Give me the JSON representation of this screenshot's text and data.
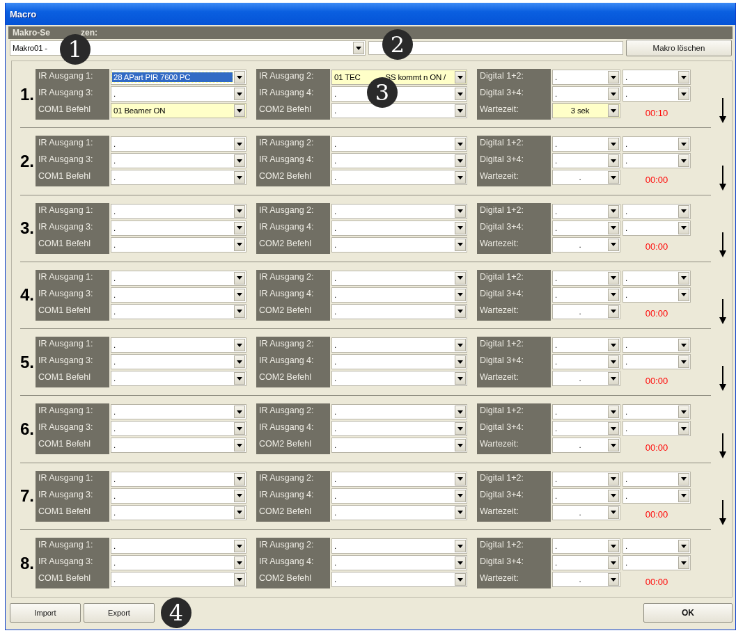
{
  "window": {
    "title": "Macro"
  },
  "header": {
    "label_parts": [
      "Makro-Se",
      "zen:"
    ],
    "macro_combo": {
      "value": "Makro01 -"
    },
    "delete_button": "Makro löschen"
  },
  "callouts": [
    "1",
    "2",
    "3",
    "4"
  ],
  "rows": [
    {
      "number": "1.",
      "time": "00:10",
      "arrow": true,
      "groups": [
        {
          "lines": [
            {
              "label": "IR Ausgang 1:",
              "combos": [
                {
                  "value": "28 APart PIR 7600 PC",
                  "highlighted": false,
                  "focused": true
                }
              ]
            },
            {
              "label": "IR Ausgang 3:",
              "combos": [
                {
                  "value": ".",
                  "highlighted": false,
                  "focused": false
                }
              ]
            },
            {
              "label": "COM1 Befehl",
              "combos": [
                {
                  "value": "01 Beamer ON",
                  "highlighted": true,
                  "focused": false
                }
              ]
            }
          ]
        },
        {
          "lines": [
            {
              "label": "IR Ausgang 2:",
              "combos": [
                {
                  "value_parts": [
                    "01 TEC",
                    "SS kommt n ON /"
                  ],
                  "highlighted": true,
                  "focused": false
                }
              ]
            },
            {
              "label": "IR Ausgang 4:",
              "combos": [
                {
                  "value": ".",
                  "highlighted": false,
                  "focused": false
                }
              ]
            },
            {
              "label": "COM2 Befehl",
              "combos": [
                {
                  "value": ".",
                  "highlighted": false,
                  "focused": false
                }
              ]
            }
          ]
        },
        {
          "lines": [
            {
              "label": "Digital 1+2:",
              "combos": [
                {
                  "value": ".",
                  "highlighted": false,
                  "focused": false
                },
                {
                  "value": ".",
                  "highlighted": false,
                  "focused": false
                }
              ]
            },
            {
              "label": "Digital 3+4:",
              "combos": [
                {
                  "value": ".",
                  "highlighted": false,
                  "focused": false
                },
                {
                  "value": ".",
                  "highlighted": false,
                  "focused": false
                }
              ]
            },
            {
              "label": "Wartezeit:",
              "combos": [
                {
                  "value": "3  sek",
                  "highlighted": true,
                  "focused": false
                }
              ]
            }
          ]
        }
      ]
    },
    {
      "number": "2.",
      "time": "00:00",
      "arrow": true,
      "groups": [
        {
          "lines": [
            {
              "label": "IR Ausgang 1:",
              "combos": [
                {
                  "value": ".",
                  "highlighted": false,
                  "focused": false
                }
              ]
            },
            {
              "label": "IR Ausgang 3:",
              "combos": [
                {
                  "value": ".",
                  "highlighted": false,
                  "focused": false
                }
              ]
            },
            {
              "label": "COM1 Befehl",
              "combos": [
                {
                  "value": ".",
                  "highlighted": false,
                  "focused": false
                }
              ]
            }
          ]
        },
        {
          "lines": [
            {
              "label": "IR Ausgang 2:",
              "combos": [
                {
                  "value": ".",
                  "highlighted": false,
                  "focused": false
                }
              ]
            },
            {
              "label": "IR Ausgang 4:",
              "combos": [
                {
                  "value": ".",
                  "highlighted": false,
                  "focused": false
                }
              ]
            },
            {
              "label": "COM2 Befehl",
              "combos": [
                {
                  "value": ".",
                  "highlighted": false,
                  "focused": false
                }
              ]
            }
          ]
        },
        {
          "lines": [
            {
              "label": "Digital 1+2:",
              "combos": [
                {
                  "value": ".",
                  "highlighted": false,
                  "focused": false
                },
                {
                  "value": ".",
                  "highlighted": false,
                  "focused": false
                }
              ]
            },
            {
              "label": "Digital 3+4:",
              "combos": [
                {
                  "value": ".",
                  "highlighted": false,
                  "focused": false
                },
                {
                  "value": ".",
                  "highlighted": false,
                  "focused": false
                }
              ]
            },
            {
              "label": "Wartezeit:",
              "combos": [
                {
                  "value": ".",
                  "highlighted": false,
                  "focused": false
                }
              ]
            }
          ]
        }
      ]
    },
    {
      "number": "3.",
      "time": "00:00",
      "arrow": true,
      "groups": [
        {
          "lines": [
            {
              "label": "IR Ausgang 1:",
              "combos": [
                {
                  "value": ".",
                  "highlighted": false,
                  "focused": false
                }
              ]
            },
            {
              "label": "IR Ausgang 3:",
              "combos": [
                {
                  "value": ".",
                  "highlighted": false,
                  "focused": false
                }
              ]
            },
            {
              "label": "COM1 Befehl",
              "combos": [
                {
                  "value": ".",
                  "highlighted": false,
                  "focused": false
                }
              ]
            }
          ]
        },
        {
          "lines": [
            {
              "label": "IR Ausgang 2:",
              "combos": [
                {
                  "value": ".",
                  "highlighted": false,
                  "focused": false
                }
              ]
            },
            {
              "label": "IR Ausgang 4:",
              "combos": [
                {
                  "value": ".",
                  "highlighted": false,
                  "focused": false
                }
              ]
            },
            {
              "label": "COM2 Befehl",
              "combos": [
                {
                  "value": ".",
                  "highlighted": false,
                  "focused": false
                }
              ]
            }
          ]
        },
        {
          "lines": [
            {
              "label": "Digital 1+2:",
              "combos": [
                {
                  "value": ".",
                  "highlighted": false,
                  "focused": false
                },
                {
                  "value": ".",
                  "highlighted": false,
                  "focused": false
                }
              ]
            },
            {
              "label": "Digital 3+4:",
              "combos": [
                {
                  "value": ".",
                  "highlighted": false,
                  "focused": false
                },
                {
                  "value": ".",
                  "highlighted": false,
                  "focused": false
                }
              ]
            },
            {
              "label": "Wartezeit:",
              "combos": [
                {
                  "value": ".",
                  "highlighted": false,
                  "focused": false
                }
              ]
            }
          ]
        }
      ]
    },
    {
      "number": "4.",
      "time": "00:00",
      "arrow": true,
      "groups": [
        {
          "lines": [
            {
              "label": "IR Ausgang 1:",
              "combos": [
                {
                  "value": ".",
                  "highlighted": false,
                  "focused": false
                }
              ]
            },
            {
              "label": "IR Ausgang 3:",
              "combos": [
                {
                  "value": ".",
                  "highlighted": false,
                  "focused": false
                }
              ]
            },
            {
              "label": "COM1 Befehl",
              "combos": [
                {
                  "value": ".",
                  "highlighted": false,
                  "focused": false
                }
              ]
            }
          ]
        },
        {
          "lines": [
            {
              "label": "IR Ausgang 2:",
              "combos": [
                {
                  "value": ".",
                  "highlighted": false,
                  "focused": false
                }
              ]
            },
            {
              "label": "IR Ausgang 4:",
              "combos": [
                {
                  "value": ".",
                  "highlighted": false,
                  "focused": false
                }
              ]
            },
            {
              "label": "COM2 Befehl",
              "combos": [
                {
                  "value": ".",
                  "highlighted": false,
                  "focused": false
                }
              ]
            }
          ]
        },
        {
          "lines": [
            {
              "label": "Digital 1+2:",
              "combos": [
                {
                  "value": ".",
                  "highlighted": false,
                  "focused": false
                },
                {
                  "value": ".",
                  "highlighted": false,
                  "focused": false
                }
              ]
            },
            {
              "label": "Digital 3+4:",
              "combos": [
                {
                  "value": ".",
                  "highlighted": false,
                  "focused": false
                },
                {
                  "value": ".",
                  "highlighted": false,
                  "focused": false
                }
              ]
            },
            {
              "label": "Wartezeit:",
              "combos": [
                {
                  "value": ".",
                  "highlighted": false,
                  "focused": false
                }
              ]
            }
          ]
        }
      ]
    },
    {
      "number": "5.",
      "time": "00:00",
      "arrow": true,
      "groups": [
        {
          "lines": [
            {
              "label": "IR Ausgang 1:",
              "combos": [
                {
                  "value": ".",
                  "highlighted": false,
                  "focused": false
                }
              ]
            },
            {
              "label": "IR Ausgang 3:",
              "combos": [
                {
                  "value": ".",
                  "highlighted": false,
                  "focused": false
                }
              ]
            },
            {
              "label": "COM1 Befehl",
              "combos": [
                {
                  "value": ".",
                  "highlighted": false,
                  "focused": false
                }
              ]
            }
          ]
        },
        {
          "lines": [
            {
              "label": "IR Ausgang 2:",
              "combos": [
                {
                  "value": ".",
                  "highlighted": false,
                  "focused": false
                }
              ]
            },
            {
              "label": "IR Ausgang 4:",
              "combos": [
                {
                  "value": ".",
                  "highlighted": false,
                  "focused": false
                }
              ]
            },
            {
              "label": "COM2 Befehl",
              "combos": [
                {
                  "value": ".",
                  "highlighted": false,
                  "focused": false
                }
              ]
            }
          ]
        },
        {
          "lines": [
            {
              "label": "Digital 1+2:",
              "combos": [
                {
                  "value": ".",
                  "highlighted": false,
                  "focused": false
                },
                {
                  "value": ".",
                  "highlighted": false,
                  "focused": false
                }
              ]
            },
            {
              "label": "Digital 3+4:",
              "combos": [
                {
                  "value": ".",
                  "highlighted": false,
                  "focused": false
                },
                {
                  "value": ".",
                  "highlighted": false,
                  "focused": false
                }
              ]
            },
            {
              "label": "Wartezeit:",
              "combos": [
                {
                  "value": ".",
                  "highlighted": false,
                  "focused": false
                }
              ]
            }
          ]
        }
      ]
    },
    {
      "number": "6.",
      "time": "00:00",
      "arrow": true,
      "groups": [
        {
          "lines": [
            {
              "label": "IR Ausgang 1:",
              "combos": [
                {
                  "value": ".",
                  "highlighted": false,
                  "focused": false
                }
              ]
            },
            {
              "label": "IR Ausgang 3:",
              "combos": [
                {
                  "value": ".",
                  "highlighted": false,
                  "focused": false
                }
              ]
            },
            {
              "label": "COM1 Befehl",
              "combos": [
                {
                  "value": ".",
                  "highlighted": false,
                  "focused": false
                }
              ]
            }
          ]
        },
        {
          "lines": [
            {
              "label": "IR Ausgang 2:",
              "combos": [
                {
                  "value": ".",
                  "highlighted": false,
                  "focused": false
                }
              ]
            },
            {
              "label": "IR Ausgang 4:",
              "combos": [
                {
                  "value": ".",
                  "highlighted": false,
                  "focused": false
                }
              ]
            },
            {
              "label": "COM2 Befehl",
              "combos": [
                {
                  "value": ".",
                  "highlighted": false,
                  "focused": false
                }
              ]
            }
          ]
        },
        {
          "lines": [
            {
              "label": "Digital 1+2:",
              "combos": [
                {
                  "value": ".",
                  "highlighted": false,
                  "focused": false
                },
                {
                  "value": ".",
                  "highlighted": false,
                  "focused": false
                }
              ]
            },
            {
              "label": "Digital 3+4:",
              "combos": [
                {
                  "value": ".",
                  "highlighted": false,
                  "focused": false
                },
                {
                  "value": ".",
                  "highlighted": false,
                  "focused": false
                }
              ]
            },
            {
              "label": "Wartezeit:",
              "combos": [
                {
                  "value": ".",
                  "highlighted": false,
                  "focused": false
                }
              ]
            }
          ]
        }
      ]
    },
    {
      "number": "7.",
      "time": "00:00",
      "arrow": true,
      "groups": [
        {
          "lines": [
            {
              "label": "IR Ausgang 1:",
              "combos": [
                {
                  "value": ".",
                  "highlighted": false,
                  "focused": false
                }
              ]
            },
            {
              "label": "IR Ausgang 3:",
              "combos": [
                {
                  "value": ".",
                  "highlighted": false,
                  "focused": false
                }
              ]
            },
            {
              "label": "COM1 Befehl",
              "combos": [
                {
                  "value": ".",
                  "highlighted": false,
                  "focused": false
                }
              ]
            }
          ]
        },
        {
          "lines": [
            {
              "label": "IR Ausgang 2:",
              "combos": [
                {
                  "value": ".",
                  "highlighted": false,
                  "focused": false
                }
              ]
            },
            {
              "label": "IR Ausgang 4:",
              "combos": [
                {
                  "value": ".",
                  "highlighted": false,
                  "focused": false
                }
              ]
            },
            {
              "label": "COM2 Befehl",
              "combos": [
                {
                  "value": ".",
                  "highlighted": false,
                  "focused": false
                }
              ]
            }
          ]
        },
        {
          "lines": [
            {
              "label": "Digital 1+2:",
              "combos": [
                {
                  "value": ".",
                  "highlighted": false,
                  "focused": false
                },
                {
                  "value": ".",
                  "highlighted": false,
                  "focused": false
                }
              ]
            },
            {
              "label": "Digital 3+4:",
              "combos": [
                {
                  "value": ".",
                  "highlighted": false,
                  "focused": false
                },
                {
                  "value": ".",
                  "highlighted": false,
                  "focused": false
                }
              ]
            },
            {
              "label": "Wartezeit:",
              "combos": [
                {
                  "value": ".",
                  "highlighted": false,
                  "focused": false
                }
              ]
            }
          ]
        }
      ]
    },
    {
      "number": "8.",
      "time": "00:00",
      "arrow": false,
      "groups": [
        {
          "lines": [
            {
              "label": "IR Ausgang 1:",
              "combos": [
                {
                  "value": ".",
                  "highlighted": false,
                  "focused": false
                }
              ]
            },
            {
              "label": "IR Ausgang 3:",
              "combos": [
                {
                  "value": ".",
                  "highlighted": false,
                  "focused": false
                }
              ]
            },
            {
              "label": "COM1 Befehl",
              "combos": [
                {
                  "value": ".",
                  "highlighted": false,
                  "focused": false
                }
              ]
            }
          ]
        },
        {
          "lines": [
            {
              "label": "IR Ausgang 2:",
              "combos": [
                {
                  "value": ".",
                  "highlighted": false,
                  "focused": false
                }
              ]
            },
            {
              "label": "IR Ausgang 4:",
              "combos": [
                {
                  "value": ".",
                  "highlighted": false,
                  "focused": false
                }
              ]
            },
            {
              "label": "COM2 Befehl",
              "combos": [
                {
                  "value": ".",
                  "highlighted": false,
                  "focused": false
                }
              ]
            }
          ]
        },
        {
          "lines": [
            {
              "label": "Digital 1+2:",
              "combos": [
                {
                  "value": ".",
                  "highlighted": false,
                  "focused": false
                },
                {
                  "value": ".",
                  "highlighted": false,
                  "focused": false
                }
              ]
            },
            {
              "label": "Digital 3+4:",
              "combos": [
                {
                  "value": ".",
                  "highlighted": false,
                  "focused": false
                },
                {
                  "value": ".",
                  "highlighted": false,
                  "focused": false
                }
              ]
            },
            {
              "label": "Wartezeit:",
              "combos": [
                {
                  "value": ".",
                  "highlighted": false,
                  "focused": false
                }
              ]
            }
          ]
        }
      ]
    }
  ],
  "footer": {
    "buttons": [
      "Import",
      "Export"
    ],
    "ok_button": "OK"
  }
}
